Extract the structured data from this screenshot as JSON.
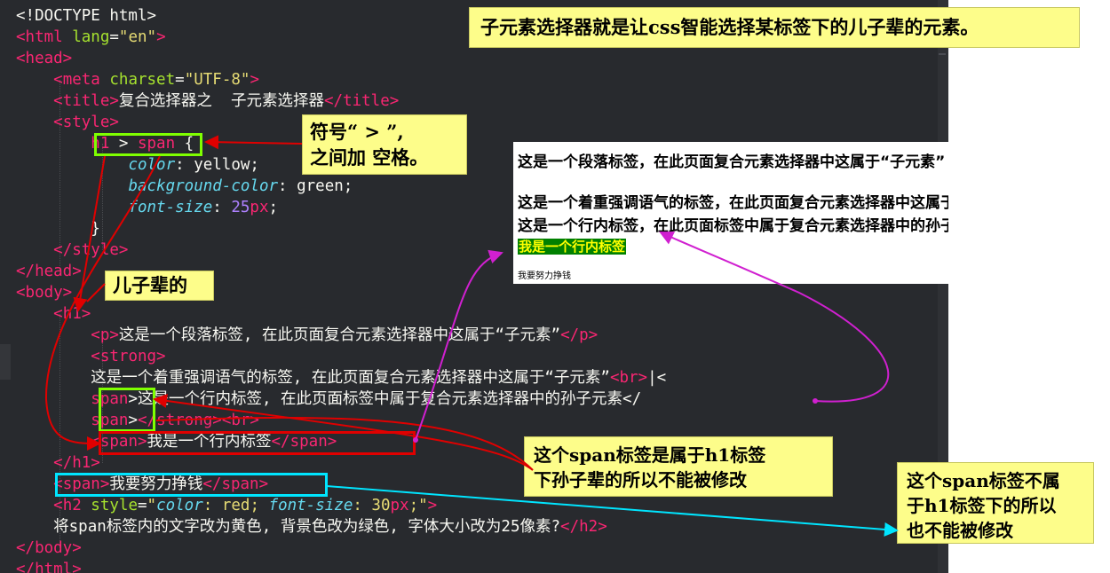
{
  "editor": {
    "lines": [
      [
        {
          "c": "d",
          "t": "<!DOCTYPE html>"
        }
      ],
      [
        {
          "c": "t",
          "t": "<html"
        },
        {
          "c": "a",
          "t": " lang"
        },
        {
          "c": "d",
          "t": "="
        },
        {
          "c": "s",
          "t": "\"en\""
        },
        {
          "c": "t",
          "t": ">"
        }
      ],
      [
        {
          "c": "t",
          "t": "<head>"
        }
      ],
      [
        {
          "c": "d",
          "t": "    "
        },
        {
          "c": "t",
          "t": "<meta"
        },
        {
          "c": "a",
          "t": " charset"
        },
        {
          "c": "d",
          "t": "="
        },
        {
          "c": "s",
          "t": "\"UTF-8\""
        },
        {
          "c": "t",
          "t": ">"
        }
      ],
      [
        {
          "c": "d",
          "t": "    "
        },
        {
          "c": "t",
          "t": "<title>"
        },
        {
          "c": "d",
          "t": "复合选择器之  子元素选择器"
        },
        {
          "c": "t",
          "t": "</title>"
        }
      ],
      [
        {
          "c": "d",
          "t": "    "
        },
        {
          "c": "t",
          "t": "<style>"
        }
      ],
      [
        {
          "c": "d",
          "t": "        "
        },
        {
          "c": "t",
          "t": "h1"
        },
        {
          "c": "d",
          "t": " > "
        },
        {
          "c": "t",
          "t": "span"
        },
        {
          "c": "d",
          "t": " {"
        }
      ],
      [
        {
          "c": "d",
          "t": "            "
        },
        {
          "c": "p",
          "t": "color"
        },
        {
          "c": "d",
          "t": ": "
        },
        {
          "c": "d",
          "t": "yellow;"
        }
      ],
      [
        {
          "c": "d",
          "t": "            "
        },
        {
          "c": "p",
          "t": "background-color"
        },
        {
          "c": "d",
          "t": ": "
        },
        {
          "c": "d",
          "t": "green;"
        }
      ],
      [
        {
          "c": "d",
          "t": "            "
        },
        {
          "c": "p",
          "t": "font-size"
        },
        {
          "c": "d",
          "t": ": "
        },
        {
          "c": "n",
          "t": "25"
        },
        {
          "c": "u",
          "t": "px"
        },
        {
          "c": "d",
          "t": ";"
        }
      ],
      [
        {
          "c": "d",
          "t": "        }"
        }
      ],
      [
        {
          "c": "d",
          "t": "    "
        },
        {
          "c": "t",
          "t": "</style>"
        }
      ],
      [
        {
          "c": "t",
          "t": "</head>"
        }
      ],
      [
        {
          "c": "t",
          "t": "<body>"
        }
      ],
      [
        {
          "c": "d",
          "t": "    "
        },
        {
          "c": "t",
          "t": "<h1>"
        }
      ],
      [
        {
          "c": "d",
          "t": "        "
        },
        {
          "c": "t",
          "t": "<p>"
        },
        {
          "c": "d",
          "t": "这是一个段落标签, 在此页面复合元素选择器中这属于“子元素”"
        },
        {
          "c": "t",
          "t": "</p>"
        }
      ],
      [
        {
          "c": "d",
          "t": "        "
        },
        {
          "c": "t",
          "t": "<strong>"
        }
      ],
      [
        {
          "c": "d",
          "t": "        这是一个着重强调语气的标签, 在此页面复合元素选择器中这属于“子元素”"
        },
        {
          "c": "t",
          "t": "<br>"
        },
        {
          "c": "d",
          "t": "|<"
        }
      ],
      [
        {
          "c": "d",
          "t": "        "
        },
        {
          "c": "t",
          "t": "span"
        },
        {
          "c": "d",
          "t": ">这是一个行内标签, 在此页面标签中属于复合元素选择器中的孙子元素</"
        }
      ],
      [
        {
          "c": "d",
          "t": "        "
        },
        {
          "c": "t",
          "t": "span"
        },
        {
          "c": "d",
          "t": ">"
        },
        {
          "c": "t",
          "t": "</strong>"
        },
        {
          "c": "t",
          "t": "<br>"
        }
      ],
      [
        {
          "c": "d",
          "t": "        "
        },
        {
          "c": "t",
          "t": "<span>"
        },
        {
          "c": "d",
          "t": "我是一个行内标签"
        },
        {
          "c": "t",
          "t": "</span>"
        }
      ],
      [
        {
          "c": "d",
          "t": "    "
        },
        {
          "c": "t",
          "t": "</h1>"
        }
      ],
      [
        {
          "c": "d",
          "t": "    "
        },
        {
          "c": "t",
          "t": "<span>"
        },
        {
          "c": "d",
          "t": "我要努力挣钱"
        },
        {
          "c": "t",
          "t": "</span>"
        }
      ],
      [
        {
          "c": "d",
          "t": "    "
        },
        {
          "c": "t",
          "t": "<h2"
        },
        {
          "c": "a",
          "t": " style"
        },
        {
          "c": "d",
          "t": "="
        },
        {
          "c": "s",
          "t": "\""
        },
        {
          "c": "p",
          "t": "color"
        },
        {
          "c": "s",
          "t": ": red; "
        },
        {
          "c": "p",
          "t": "font-size"
        },
        {
          "c": "s",
          "t": ": 30"
        },
        {
          "c": "u",
          "t": "px"
        },
        {
          "c": "s",
          "t": ";\""
        },
        {
          "c": "t",
          "t": ">"
        }
      ],
      [
        {
          "c": "d",
          "t": "    将span标签内的文字改为黄色, 背景色改为绿色, 字体大小改为25像素?"
        },
        {
          "c": "t",
          "t": "</h2>"
        }
      ],
      [
        {
          "c": "t",
          "t": "</body>"
        }
      ],
      [
        {
          "c": "t",
          "t": "</html>"
        }
      ]
    ]
  },
  "notes": {
    "top": "子元素选择器就是让css智能选择某标签下的儿子辈的元素。",
    "symbol_line1": "符号“ > ”,",
    "symbol_line2": "之间加 空格。",
    "son": "儿子辈的",
    "grandson_line1": "这个span标签是属于h1标签",
    "grandson_line2": "下孙子辈的所以不能被修改",
    "outside_line1": "这个span标签不属",
    "outside_line2": "于h1标签下的所以",
    "outside_line3": "也不能被修改"
  },
  "preview": {
    "p_text": "这是一个段落标签，在此页面复合元素选择器中这属于“子元素”",
    "strong_text": "这是一个着重强调语气的标签，在此页面复合元素选择器中这属于“子元素”",
    "strong_span_text": "这是一个行内标签，在此页面标签中属于复合元素选择器中的孙子元素",
    "span_text": "我是一个行内标签",
    "body_span_text": "我要努力挣钱"
  },
  "colors": {
    "editor_bg": "#282a2e",
    "tag": "#f92672",
    "attr": "#a6e22e",
    "string": "#e6db74",
    "property": "#66d9ef",
    "number": "#ae81ff",
    "note_bg": "#fdfd8a",
    "box_green": "#7fff00",
    "box_red": "#e00000",
    "box_cyan": "#00e5ff",
    "arrow_magenta": "#d020d0"
  }
}
